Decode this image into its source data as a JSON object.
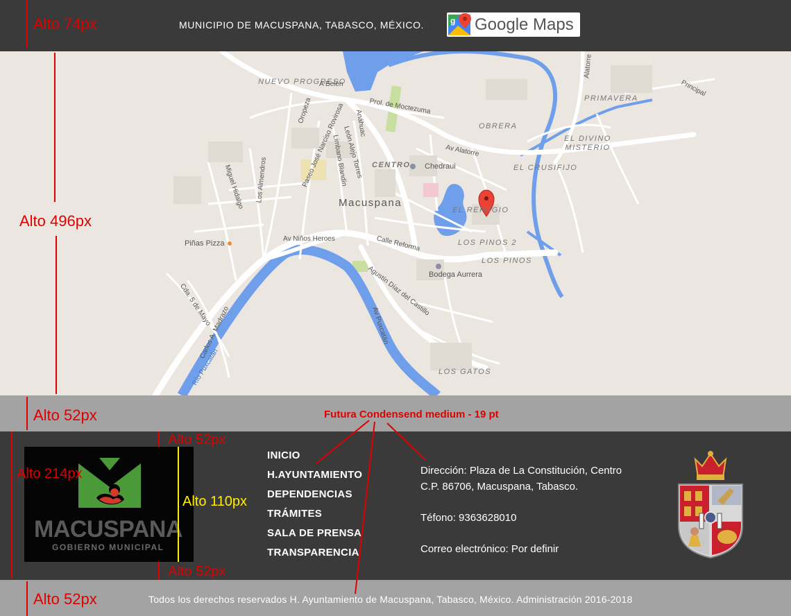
{
  "header": {
    "municipio_text": "MUNICIPIO DE MACUSPANA, TABASCO, MÉXICO.",
    "google_maps_label": "Google Maps"
  },
  "map": {
    "city_label": "Macuspana",
    "neighborhoods": [
      "NUEVO PROGRESO",
      "CENTRO",
      "OBRERA",
      "PRIMAVERA",
      "EL DIVINO MISTERIO",
      "EL CRUSIFIJO",
      "EL REFUGIO",
      "LOS PINOS 2",
      "LOS PINOS",
      "LOS GATOS"
    ],
    "streets": [
      "A Belén",
      "Prol. de Moctezuma",
      "Oropeza",
      "Paseo José Narciso Rovirosa",
      "León Alejo Torres",
      "Limbano Blandín",
      "Anáhuac",
      "Av Alatorre",
      "Alatorre",
      "Principal",
      "Los Almendros",
      "Miguel Hidalgo",
      "Av Niños Heroes",
      "Calle Reforma",
      "Agustín Díaz del Castillo",
      "Av Puxcatán",
      "Carlos A. Madrazo",
      "Cda. 5 de Mayo"
    ],
    "river": "Río Puxcatán",
    "pois": [
      "Chedraui",
      "Piñas Pizza",
      "Bodega Aurrera"
    ]
  },
  "footer": {
    "logo_word": "MACUSPANA",
    "logo_sub": "GOBIERNO MUNICIPAL",
    "nav": [
      "INICIO",
      "H.AYUNTAMIENTO",
      "DEPENDENCIAS",
      "TRÁMITES",
      "SALA DE PRENSA",
      "TRANSPARENCIA"
    ],
    "contact": {
      "direccion_1": "Dirección: Plaza de La Constitución, Centro",
      "direccion_2": "C.P. 86706, Macuspana, Tabasco.",
      "telefono": "Téfono: 9363628010",
      "correo": "Correo electrónico: Por definir"
    },
    "copyright": "Todos los derechos reservados H. Ayuntamiento de Macuspana, Tabasco, México. Administración 2016-2018"
  },
  "annotations": {
    "alto_74": "Alto 74px",
    "alto_496": "Alto 496px",
    "alto_52_top": "Alto 52px",
    "alto_214": "Alto 214px",
    "alto_52_logo_top": "Alto 52px",
    "alto_110": "Alto 110px",
    "alto_52_logo_bottom": "Alto 52px",
    "alto_52_bottom": "Alto 52px",
    "font_note": "Futura Condensend medium - 19 pt"
  },
  "colors": {
    "dark_bar": "#3a3a3a",
    "gray_band": "#a3a3a3",
    "annotation_red": "#e00000",
    "annotation_yellow": "#ffee00",
    "river_blue": "#6f9fea",
    "map_bg": "#ebe7e0"
  },
  "icons": {
    "google_maps": "google-maps-pin-icon",
    "map_marker": "red-location-pin",
    "escudo": "tabasco-coat-of-arms"
  }
}
